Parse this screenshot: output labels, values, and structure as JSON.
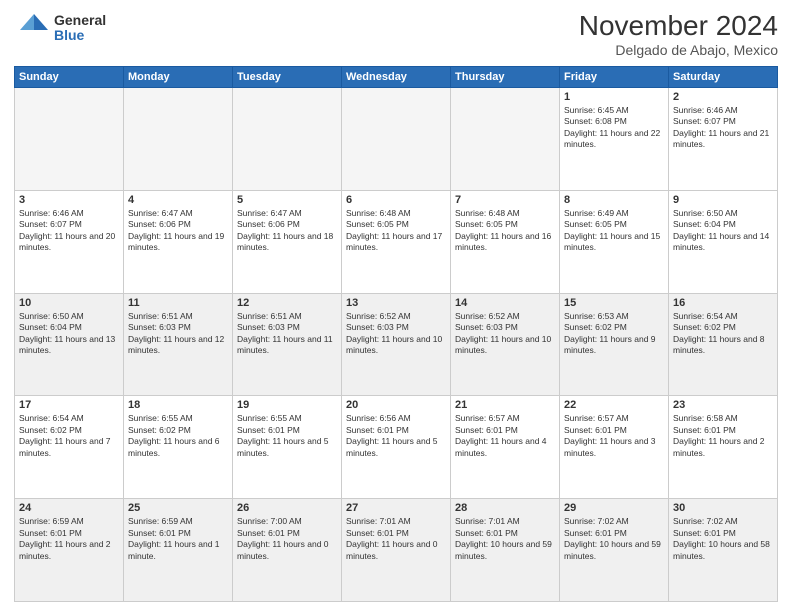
{
  "logo": {
    "general": "General",
    "blue": "Blue"
  },
  "title": "November 2024",
  "location": "Delgado de Abajo, Mexico",
  "weekdays": [
    "Sunday",
    "Monday",
    "Tuesday",
    "Wednesday",
    "Thursday",
    "Friday",
    "Saturday"
  ],
  "weeks": [
    [
      {
        "day": "",
        "empty": true
      },
      {
        "day": "",
        "empty": true
      },
      {
        "day": "",
        "empty": true
      },
      {
        "day": "",
        "empty": true
      },
      {
        "day": "",
        "empty": true
      },
      {
        "day": "1",
        "sunrise": "6:45 AM",
        "sunset": "6:08 PM",
        "daylight": "11 hours and 22 minutes."
      },
      {
        "day": "2",
        "sunrise": "6:46 AM",
        "sunset": "6:07 PM",
        "daylight": "11 hours and 21 minutes."
      }
    ],
    [
      {
        "day": "3",
        "sunrise": "6:46 AM",
        "sunset": "6:07 PM",
        "daylight": "11 hours and 20 minutes."
      },
      {
        "day": "4",
        "sunrise": "6:47 AM",
        "sunset": "6:06 PM",
        "daylight": "11 hours and 19 minutes."
      },
      {
        "day": "5",
        "sunrise": "6:47 AM",
        "sunset": "6:06 PM",
        "daylight": "11 hours and 18 minutes."
      },
      {
        "day": "6",
        "sunrise": "6:48 AM",
        "sunset": "6:05 PM",
        "daylight": "11 hours and 17 minutes."
      },
      {
        "day": "7",
        "sunrise": "6:48 AM",
        "sunset": "6:05 PM",
        "daylight": "11 hours and 16 minutes."
      },
      {
        "day": "8",
        "sunrise": "6:49 AM",
        "sunset": "6:05 PM",
        "daylight": "11 hours and 15 minutes."
      },
      {
        "day": "9",
        "sunrise": "6:50 AM",
        "sunset": "6:04 PM",
        "daylight": "11 hours and 14 minutes."
      }
    ],
    [
      {
        "day": "10",
        "sunrise": "6:50 AM",
        "sunset": "6:04 PM",
        "daylight": "11 hours and 13 minutes."
      },
      {
        "day": "11",
        "sunrise": "6:51 AM",
        "sunset": "6:03 PM",
        "daylight": "11 hours and 12 minutes."
      },
      {
        "day": "12",
        "sunrise": "6:51 AM",
        "sunset": "6:03 PM",
        "daylight": "11 hours and 11 minutes."
      },
      {
        "day": "13",
        "sunrise": "6:52 AM",
        "sunset": "6:03 PM",
        "daylight": "11 hours and 10 minutes."
      },
      {
        "day": "14",
        "sunrise": "6:52 AM",
        "sunset": "6:03 PM",
        "daylight": "11 hours and 10 minutes."
      },
      {
        "day": "15",
        "sunrise": "6:53 AM",
        "sunset": "6:02 PM",
        "daylight": "11 hours and 9 minutes."
      },
      {
        "day": "16",
        "sunrise": "6:54 AM",
        "sunset": "6:02 PM",
        "daylight": "11 hours and 8 minutes."
      }
    ],
    [
      {
        "day": "17",
        "sunrise": "6:54 AM",
        "sunset": "6:02 PM",
        "daylight": "11 hours and 7 minutes."
      },
      {
        "day": "18",
        "sunrise": "6:55 AM",
        "sunset": "6:02 PM",
        "daylight": "11 hours and 6 minutes."
      },
      {
        "day": "19",
        "sunrise": "6:55 AM",
        "sunset": "6:01 PM",
        "daylight": "11 hours and 5 minutes."
      },
      {
        "day": "20",
        "sunrise": "6:56 AM",
        "sunset": "6:01 PM",
        "daylight": "11 hours and 5 minutes."
      },
      {
        "day": "21",
        "sunrise": "6:57 AM",
        "sunset": "6:01 PM",
        "daylight": "11 hours and 4 minutes."
      },
      {
        "day": "22",
        "sunrise": "6:57 AM",
        "sunset": "6:01 PM",
        "daylight": "11 hours and 3 minutes."
      },
      {
        "day": "23",
        "sunrise": "6:58 AM",
        "sunset": "6:01 PM",
        "daylight": "11 hours and 2 minutes."
      }
    ],
    [
      {
        "day": "24",
        "sunrise": "6:59 AM",
        "sunset": "6:01 PM",
        "daylight": "11 hours and 2 minutes."
      },
      {
        "day": "25",
        "sunrise": "6:59 AM",
        "sunset": "6:01 PM",
        "daylight": "11 hours and 1 minute."
      },
      {
        "day": "26",
        "sunrise": "7:00 AM",
        "sunset": "6:01 PM",
        "daylight": "11 hours and 0 minutes."
      },
      {
        "day": "27",
        "sunrise": "7:01 AM",
        "sunset": "6:01 PM",
        "daylight": "11 hours and 0 minutes."
      },
      {
        "day": "28",
        "sunrise": "7:01 AM",
        "sunset": "6:01 PM",
        "daylight": "10 hours and 59 minutes."
      },
      {
        "day": "29",
        "sunrise": "7:02 AM",
        "sunset": "6:01 PM",
        "daylight": "10 hours and 59 minutes."
      },
      {
        "day": "30",
        "sunrise": "7:02 AM",
        "sunset": "6:01 PM",
        "daylight": "10 hours and 58 minutes."
      }
    ]
  ]
}
